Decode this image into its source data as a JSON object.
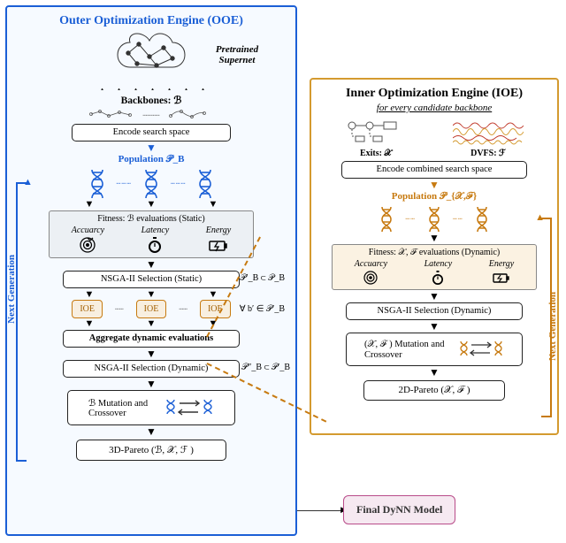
{
  "ooe": {
    "title": "Outer Optimization Engine (OOE)",
    "supernet_label": "Pretrained Supernet",
    "backbones_label": "Backbones: ℬ",
    "encode": "Encode search space",
    "population": "Population 𝒫_B",
    "fitness_title": "Fitness: ℬ  evaluations (Static)",
    "fit_cols": [
      "Accuarcy",
      "Latency",
      "Energy"
    ],
    "nsga_static": "NSGA-II Selection (Static)",
    "nsga_static_note": "𝒫′_B ⊂ 𝒫_B",
    "ioe_box": "IOE",
    "ioe_note": "∀ b′ ∈  𝒫′_B",
    "aggregate": "Aggregate dynamic evaluations",
    "nsga_dyn": "NSGA-II Selection (Dynamic)",
    "nsga_dyn_note": "𝒫″_B ⊂ 𝒫′_B",
    "mutation": "ℬ  Mutation and Crossover",
    "pareto": "3D-Pareto (ℬ, 𝒳, ℱ )",
    "loop_label": "Next Generation"
  },
  "ioe": {
    "title": "Inner Optimization Engine (IOE)",
    "subtitle": "for every candidate backbone",
    "exits_label": "Exits: 𝒳",
    "dvfs_label": "DVFS: ℱ",
    "encode": "Encode combined search space",
    "population": "Population 𝒫_{𝒳,ℱ}",
    "fitness_title": "Fitness: 𝒳, ℱ  evaluations (Dynamic)",
    "fit_cols": [
      "Accuarcy",
      "Latency",
      "Energy"
    ],
    "nsga": "NSGA-II Selection (Dynamic)",
    "mutation": "(𝒳,  ℱ ) Mutation and Crossover",
    "pareto": "2D-Pareto (𝒳,  ℱ )",
    "loop_label": "Next Generation"
  },
  "final": "Final DyNN Model",
  "icons": {
    "accuracy": "target-icon",
    "latency": "stopwatch-icon",
    "energy": "battery-icon",
    "dna": "dna-icon",
    "brain": "brain-icon"
  }
}
